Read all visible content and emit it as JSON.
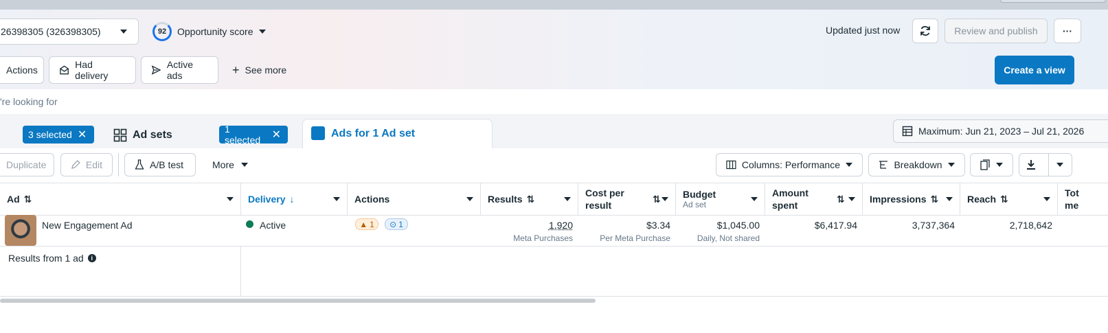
{
  "header": {
    "account_label": "26398305 (326398305)",
    "opportunity_score": "92",
    "opportunity_label": "Opportunity score",
    "updated_text": "Updated just now",
    "review_publish_label": "Review and publish",
    "more_label": "···"
  },
  "filters": {
    "chips": [
      "Actions",
      "Had delivery",
      "Active ads"
    ],
    "see_more_label": "See more",
    "create_view_label": "Create a view"
  },
  "search": {
    "placeholder": "'re looking for"
  },
  "tabs": {
    "campaigns_selected": "3 selected",
    "adsets_label": "Ad sets",
    "adsets_selected": "1 selected",
    "ads_label": "Ads for 1 Ad set"
  },
  "date_range": "Maximum: Jun 21, 2023 – Jul 21, 2026",
  "toolbar": {
    "duplicate_label": "Duplicate",
    "edit_label": "Edit",
    "ab_test_label": "A/B test",
    "more_label": "More",
    "columns_label": "Columns: Performance",
    "breakdown_label": "Breakdown"
  },
  "table": {
    "columns": {
      "ad": "Ad",
      "delivery": "Delivery",
      "actions": "Actions",
      "results": "Results",
      "cost_per_result": "Cost per result",
      "budget": "Budget",
      "budget_sub": "Ad set",
      "amount_spent": "Amount spent",
      "impressions": "Impressions",
      "reach": "Reach",
      "total": "Tot me"
    },
    "rows": [
      {
        "ad_name": "New Engagement Ad",
        "delivery": "Active",
        "actions_warning_count": "1",
        "actions_opportunity_count": "1",
        "results": "1,920",
        "results_sub": "Meta Purchases",
        "cost_per_result": "$3.34",
        "cost_per_result_sub": "Per Meta Purchase",
        "budget": "$1,045.00",
        "budget_sub": "Daily, Not shared",
        "amount_spent": "$6,417.94",
        "impressions": "3,737,364",
        "reach": "2,718,642"
      }
    ],
    "summary_label": "Results from 1 ad"
  },
  "colors": {
    "accent": "#0a78c2",
    "active": "#0f7b58",
    "warning": "#b85c00"
  }
}
